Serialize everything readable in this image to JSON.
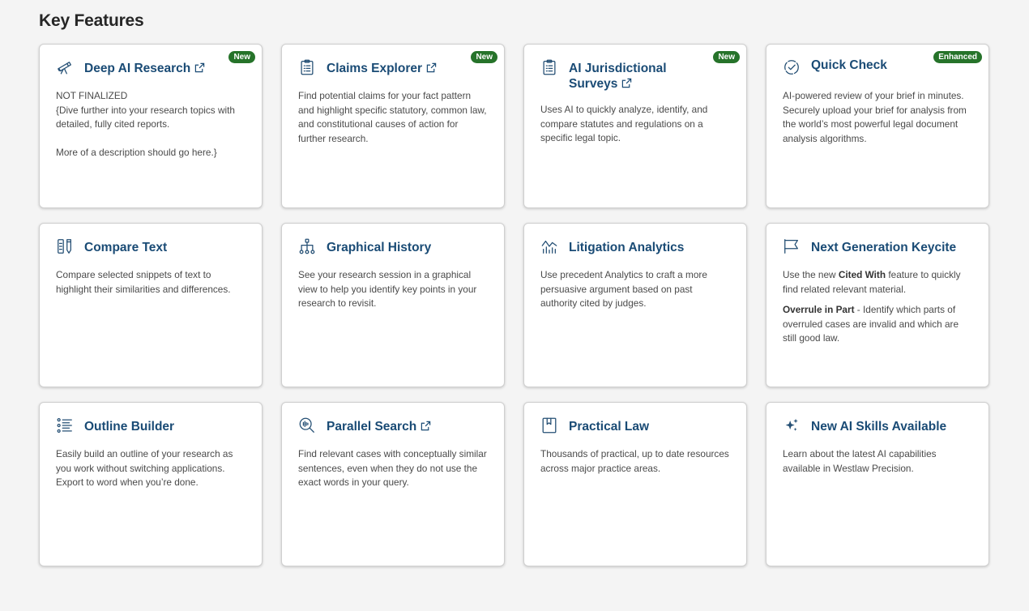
{
  "section_title": "Key Features",
  "colors": {
    "accent": "#1a4b75",
    "badge": "#26732a",
    "background": "#f4f4f4"
  },
  "cards": [
    {
      "title": "Deep AI Research",
      "icon": "telescope-icon",
      "external": true,
      "badge": "New",
      "desc_1": "NOT FINALIZED",
      "desc_2": "{Dive further into your research topics with detailed, fully cited reports.",
      "desc_3": "More of a description should go here.}"
    },
    {
      "title": "Claims Explorer",
      "icon": "clipboard-list-icon",
      "external": true,
      "badge": "New",
      "desc_1": "Find potential claims for your fact pattern and highlight specific statutory, common law, and constitutional causes of action for further research."
    },
    {
      "title": "AI Jurisdictional Surveys",
      "icon": "clipboard-list-icon",
      "external": true,
      "badge": "New",
      "desc_1": "Uses AI to quickly analyze, identify, and compare statutes and regulations on a specific legal topic."
    },
    {
      "title": "Quick Check",
      "icon": "check-circle-dashed-icon",
      "external": false,
      "badge": "Enhanced",
      "desc_1": "AI-powered review of your brief in minutes. Securely upload your brief for analysis from the world’s most powerful legal document analysis algorithms."
    },
    {
      "title": "Compare Text",
      "icon": "compare-columns-icon",
      "external": false,
      "desc_1": "Compare selected snippets of text to highlight their similarities and differences."
    },
    {
      "title": "Graphical History",
      "icon": "hierarchy-icon",
      "external": false,
      "desc_1": "See your research session in a graphical view to help you identify key points in your research to revisit."
    },
    {
      "title": "Litigation Analytics",
      "icon": "analytics-chart-icon",
      "external": false,
      "desc_1": "Use precedent Analytics to craft a more persuasive argument based on past authority cited by judges."
    },
    {
      "title": "Next Generation Keycite",
      "icon": "flag-icon",
      "external": false,
      "desc_1_pre": "Use the new ",
      "desc_1_bold": "Cited With",
      "desc_1_post": " feature to quickly find related relevant material.",
      "desc_2_bold": "Overrule in Part",
      "desc_2_post": " - Identify which parts of overruled cases are invalid and which are still good law."
    },
    {
      "title": "Outline Builder",
      "icon": "list-outline-icon",
      "external": false,
      "desc_1": "Easily build an outline of your research as you work without switching applications. Export to word when you’re done."
    },
    {
      "title": "Parallel Search",
      "icon": "search-waveform-icon",
      "external": true,
      "desc_1": "Find relevant cases with conceptually similar sentences, even when they do not use the exact words in your query."
    },
    {
      "title": "Practical Law",
      "icon": "bookmark-book-icon",
      "external": false,
      "desc_1": "Thousands of practical, up to date resources across major practice areas."
    },
    {
      "title": "New AI Skills Available",
      "icon": "sparkle-icon",
      "external": false,
      "desc_1": "Learn about the latest AI capabilities available in Westlaw Precision."
    }
  ]
}
